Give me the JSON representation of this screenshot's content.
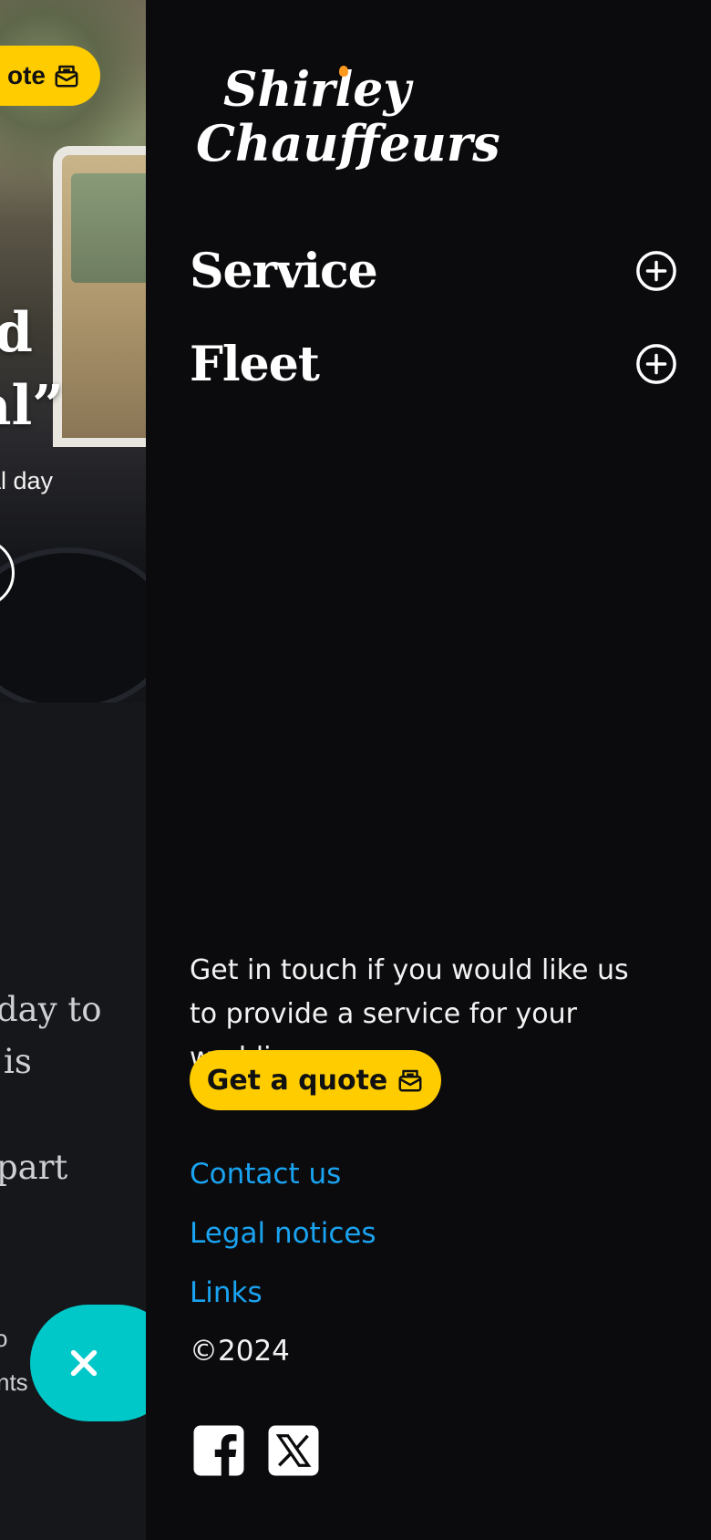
{
  "background_page": {
    "hero_button_label": "ote",
    "hero_heading_line1": "d",
    "hero_heading_line2": "nal”",
    "hero_subtext": "al day",
    "body_line1": "day to",
    "body_line2": "is",
    "body_line3": "part",
    "small_line1": "o",
    "small_line2": "nts"
  },
  "close_button": {
    "icon": "close-icon",
    "color": "#00c8c8"
  },
  "drawer": {
    "logo": {
      "line1": "Shirley",
      "line2": "Chauffeurs",
      "accent": "#ff9a1f"
    },
    "nav": [
      {
        "label": "Service",
        "icon": "plus-circle-icon"
      },
      {
        "label": "Fleet",
        "icon": "plus-circle-icon"
      }
    ],
    "contact_text": "Get in touch if you would like us to provide a service for your wedding",
    "quote_button": {
      "label": "Get a quote",
      "icon": "mail-envelope-icon",
      "color": "#ffcc00"
    },
    "links": [
      {
        "label": "Contact us"
      },
      {
        "label": "Legal notices"
      },
      {
        "label": "Links"
      }
    ],
    "copyright": "©2024",
    "social": [
      {
        "name": "facebook-icon"
      },
      {
        "name": "x-twitter-icon"
      }
    ],
    "link_color": "#1aa3f0"
  }
}
